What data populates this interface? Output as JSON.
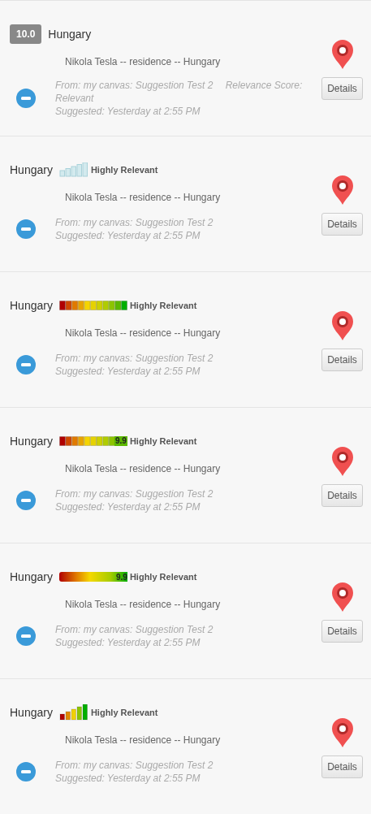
{
  "suggestions": [
    {
      "kind": "score-badge",
      "score": "10.0",
      "title": "Hungary",
      "description": "Nikola Tesla -- residence -- Hungary",
      "source": "From: my canvas: Suggestion Test 2",
      "relevance": "Relevance Score: Relevant",
      "suggested": "Suggested: Yesterday at 2:55 PM",
      "button": "Details"
    },
    {
      "kind": "light-bars",
      "title": "Hungary",
      "relevance_label": "Highly Relevant",
      "description": "Nikola Tesla -- residence -- Hungary",
      "source": "From: my canvas: Suggestion Test 2",
      "suggested": "Suggested: Yesterday at 2:55 PM",
      "button": "Details"
    },
    {
      "kind": "segments",
      "title": "Hungary",
      "relevance_label": "Highly Relevant",
      "description": "Nikola Tesla -- residence -- Hungary",
      "source": "From: my canvas: Suggestion Test 2",
      "suggested": "Suggested: Yesterday at 2:55 PM",
      "button": "Details"
    },
    {
      "kind": "segments",
      "score": "9.9",
      "title": "Hungary",
      "relevance_label": "Highly Relevant",
      "description": "Nikola Tesla -- residence -- Hungary",
      "source": "From: my canvas: Suggestion Test 2",
      "suggested": "Suggested: Yesterday at 2:55 PM",
      "button": "Details"
    },
    {
      "kind": "gradient",
      "score": "9.9",
      "title": "Hungary",
      "relevance_label": "Highly Relevant",
      "description": "Nikola Tesla -- residence -- Hungary",
      "source": "From: my canvas: Suggestion Test 2",
      "suggested": "Suggested: Yesterday at 2:55 PM",
      "button": "Details"
    },
    {
      "kind": "color-bars",
      "title": "Hungary",
      "relevance_label": "Highly Relevant",
      "description": "Nikola Tesla -- residence -- Hungary",
      "source": "From: my canvas: Suggestion Test 2",
      "suggested": "Suggested: Yesterday at 2:55 PM",
      "button": "Details"
    }
  ]
}
